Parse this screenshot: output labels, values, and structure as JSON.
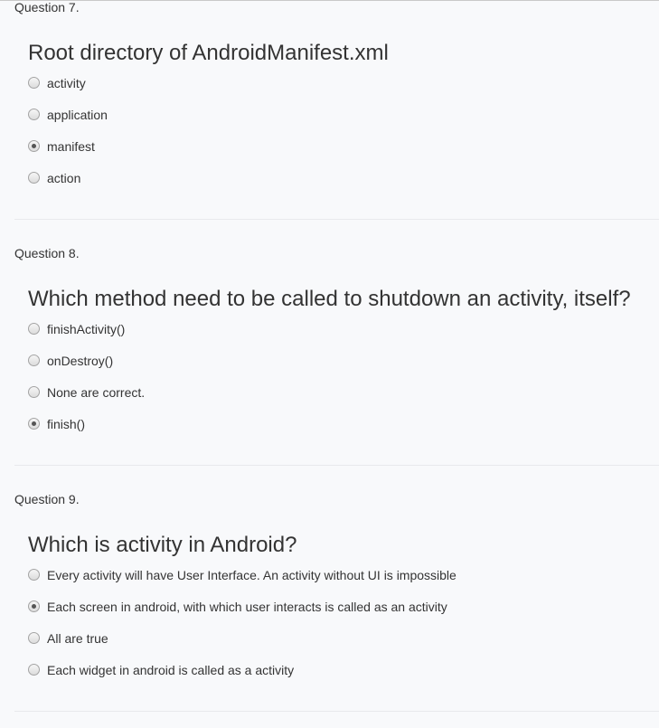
{
  "questions": [
    {
      "label": "Question 7.",
      "title": "Root directory of AndroidManifest.xml",
      "selected_index": 2,
      "options": [
        "activity",
        "application",
        "manifest",
        "action"
      ]
    },
    {
      "label": "Question 8.",
      "title": "Which method need to be called to shutdown an activity, itself?",
      "selected_index": 3,
      "options": [
        "finishActivity()",
        "onDestroy()",
        "None are correct.",
        "finish()"
      ]
    },
    {
      "label": "Question 9.",
      "title": "Which is activity in Android?",
      "selected_index": 1,
      "options": [
        "Every activity will have User Interface. An activity without UI is impossible",
        "Each screen in android, with which user interacts is called as an activity",
        "All are true",
        "Each widget in android is called as a activity"
      ]
    }
  ]
}
